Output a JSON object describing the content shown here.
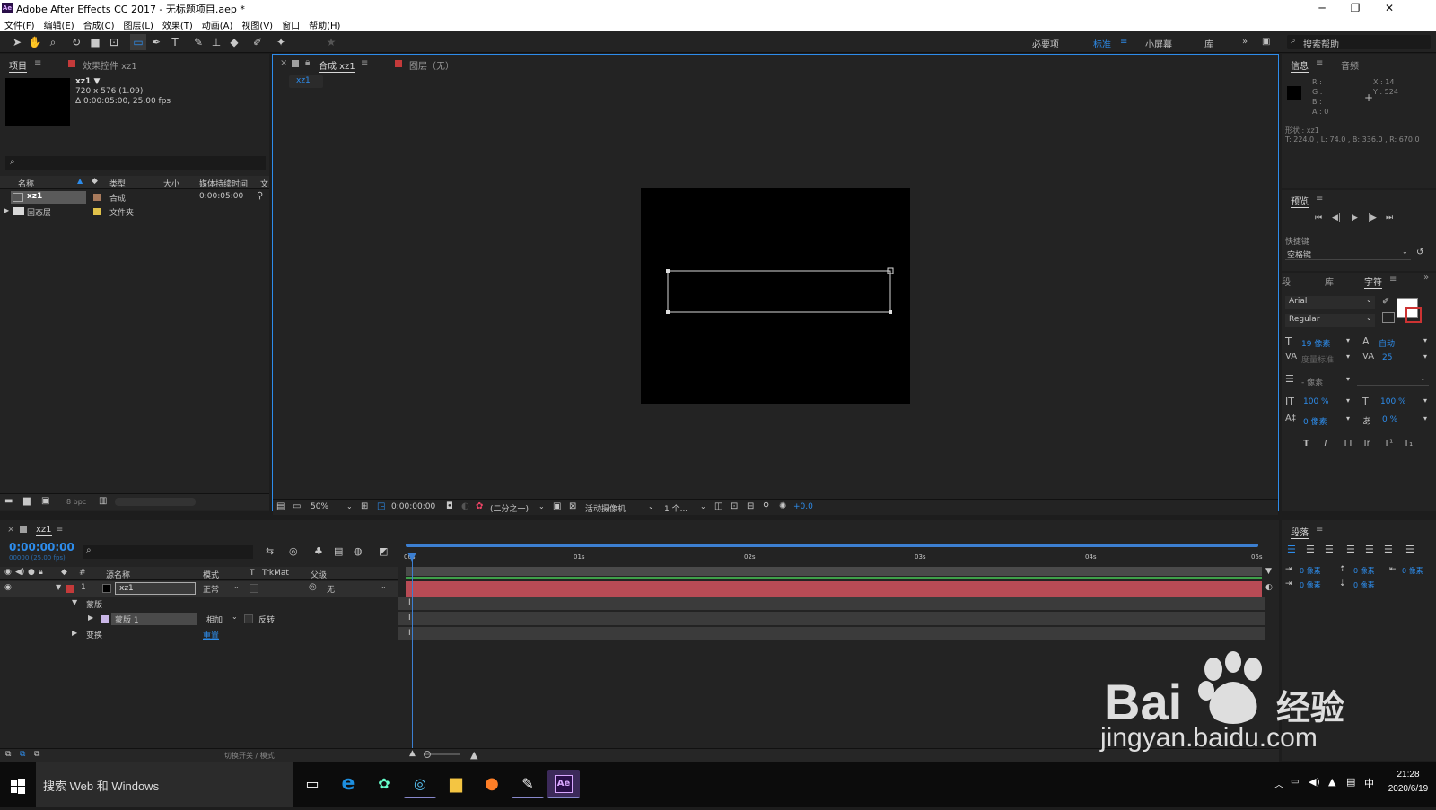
{
  "window": {
    "title": "Adobe After Effects CC 2017 - 无标题项目.aep *",
    "app_icon": "Ae",
    "minimize": "─",
    "restore": "❐",
    "close": "✕"
  },
  "menu": [
    "文件(F)",
    "编辑(E)",
    "合成(C)",
    "图层(L)",
    "效果(T)",
    "动画(A)",
    "视图(V)",
    "窗口",
    "帮助(H)"
  ],
  "workspaces": {
    "essentials": "必要项",
    "standard": "标准",
    "small_screen": "小屏幕",
    "library": "库",
    "search_placeholder": "搜索帮助"
  },
  "project_panel": {
    "tab_project": "项目",
    "tab_effects": "效果控件 xz1",
    "comp_name": "xz1 ▼",
    "comp_size": "720 x 576 (1.09)",
    "comp_duration": "Δ 0:00:05:00, 25.00 fps",
    "columns": [
      "名称",
      "类型",
      "大小",
      "媒体持续时间",
      "文"
    ],
    "items": [
      {
        "name": "xz1",
        "type": "合成",
        "size": "",
        "duration": "0:00:05:00",
        "color": "#a87a5c"
      },
      {
        "name": "固态层",
        "type": "文件夹",
        "size": "",
        "duration": "",
        "color": "#e0c14a"
      }
    ],
    "bpc": "8 bpc"
  },
  "comp_panel": {
    "tab_comp": "合成 xz1",
    "tab_layer": "图层（无）",
    "breadcrumb": "xz1",
    "zoom": "50%",
    "timecode": "0:00:00:00",
    "resolution": "(二分之一)",
    "camera": "活动摄像机",
    "views": "1 个...",
    "exposure": "+0.0"
  },
  "info_panel": {
    "tab_info": "信息",
    "tab_audio": "音频",
    "r": "R :",
    "g": "G :",
    "b": "B :",
    "a": "A : 0",
    "x": "X : 14",
    "y": "Y : 524",
    "shape": "形状 : xz1",
    "bounds": "T: 224.0 , L: 74.0 , B: 336.0 , R: 670.0"
  },
  "preview_panel": {
    "title": "预览",
    "shortcut_label": "快捷键",
    "shortcut_value": "空格键"
  },
  "char_panel": {
    "tab_para": "段",
    "tab_lib": "库",
    "tab_char": "字符",
    "font": "Arial",
    "style": "Regular",
    "size": "19 像素",
    "leading": "自动",
    "kerning": "度量标准",
    "tracking": "25",
    "stroke": "- 像素",
    "vscale": "100 %",
    "hscale": "100 %",
    "baseline": "0 像素",
    "tsume": "0 %",
    "styles": [
      "T",
      "T",
      "TT",
      "Tr",
      "T¹",
      "T₁"
    ]
  },
  "para_panel": {
    "title": "段落",
    "indent_values": [
      "0 像素",
      "0 像素",
      "0 像素",
      "0 像素",
      "0 像素"
    ]
  },
  "timeline": {
    "tab": "xz1",
    "timecode": "0:00:00:00",
    "frames": "00000 (25.00 fps)",
    "col_hash": "#",
    "col_source": "源名称",
    "col_mode": "模式",
    "col_t": "T",
    "col_trkmat": "TrkMat",
    "col_parent": "父级",
    "layer_num": "1",
    "layer_name": "xz1",
    "layer_mode": "正常",
    "layer_parent": "无",
    "masks_label": "蒙版",
    "mask_name": "蒙版 1",
    "mask_mode": "相加",
    "mask_invert": "反转",
    "transform_label": "变换",
    "reset": "重置",
    "toggle_label": "切换开关 / 模式",
    "ruler": [
      "00s",
      "01s",
      "02s",
      "03s",
      "04s",
      "05s"
    ]
  },
  "taskbar": {
    "search": "搜索 Web 和 Windows",
    "time": "21:28",
    "date": "2020/6/19",
    "ime": "中"
  },
  "watermark": {
    "brand": "Bai du 经验",
    "url": "jingyan.baidu.com"
  }
}
